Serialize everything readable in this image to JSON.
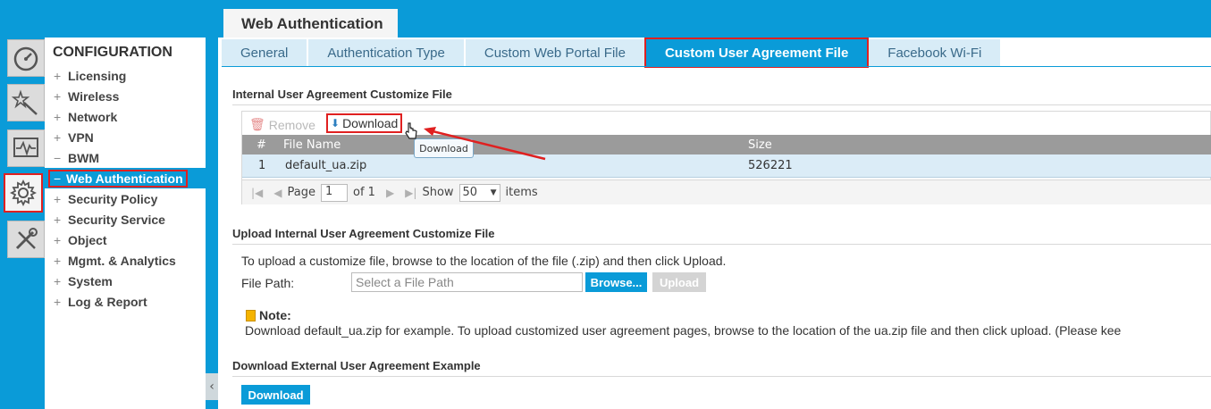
{
  "header": {
    "title": "Web Authentication"
  },
  "rail": {
    "items": [
      {
        "icon": "dashboard-icon"
      },
      {
        "icon": "wizard-icon"
      },
      {
        "icon": "monitor-icon"
      },
      {
        "icon": "gear-icon",
        "active": true
      },
      {
        "icon": "tools-icon"
      }
    ]
  },
  "menu": {
    "title": "CONFIGURATION",
    "items": [
      {
        "sign": "+",
        "label": "Licensing"
      },
      {
        "sign": "+",
        "label": "Wireless"
      },
      {
        "sign": "+",
        "label": "Network"
      },
      {
        "sign": "+",
        "label": "VPN"
      },
      {
        "sign": "−",
        "label": "BWM"
      },
      {
        "sign": "−",
        "label": "Web Authentication",
        "active": true
      },
      {
        "sign": "+",
        "label": "Security Policy"
      },
      {
        "sign": "+",
        "label": "Security Service"
      },
      {
        "sign": "+",
        "label": "Object"
      },
      {
        "sign": "+",
        "label": "Mgmt. & Analytics"
      },
      {
        "sign": "+",
        "label": "System"
      },
      {
        "sign": "+",
        "label": "Log & Report"
      }
    ],
    "collapse_glyph": "‹"
  },
  "tabs": [
    {
      "label": "General"
    },
    {
      "label": "Authentication Type"
    },
    {
      "label": "Custom Web Portal File"
    },
    {
      "label": "Custom User Agreement File",
      "active": true
    },
    {
      "label": "Facebook Wi-Fi"
    }
  ],
  "internal": {
    "heading": "Internal User Agreement Customize File",
    "toolbar": {
      "remove_label": "Remove",
      "download_label": "Download"
    },
    "columns": {
      "num": "#",
      "name": "File Name",
      "size": "Size"
    },
    "rows": [
      {
        "num": "1",
        "name": "default_ua.zip",
        "size": "526221"
      }
    ],
    "tooltip": "Download",
    "pager": {
      "page_label": "Page",
      "page_value": "1",
      "of_label": "of 1",
      "show_label": "Show",
      "show_value": "50",
      "items_label": "items"
    }
  },
  "upload": {
    "heading": "Upload Internal User Agreement Customize File",
    "instructions": "To upload a customize file, browse to the location of the file (.zip) and then click Upload.",
    "file_path_label": "File Path:",
    "file_path_placeholder": "Select a File Path",
    "browse_label": "Browse...",
    "upload_label": "Upload",
    "note_title": "Note:",
    "note_text": "Download default_ua.zip for example. To upload customized user agreement pages, browse to the location of the ua.zip file and then click upload. (Please kee"
  },
  "external": {
    "heading": "Download External User Agreement Example",
    "download_label": "Download"
  },
  "colors": {
    "accent": "#0a9bd8",
    "highlight": "#e02020",
    "row_selected": "#dbecf7"
  }
}
